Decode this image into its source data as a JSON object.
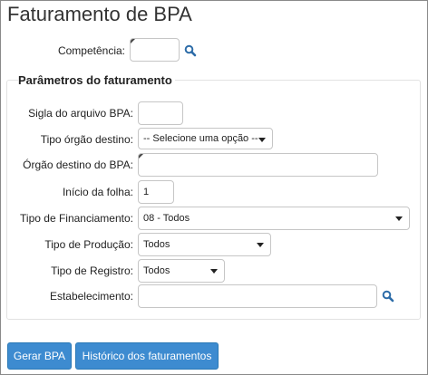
{
  "page": {
    "title": "Faturamento de BPA"
  },
  "competencia": {
    "label": "Competência:",
    "value": ""
  },
  "section": {
    "legend": "Parâmetros do faturamento"
  },
  "fields": {
    "sigla": {
      "label": "Sigla do arquivo BPA:",
      "value": ""
    },
    "tipo_orgao": {
      "label": "Tipo órgão destino:",
      "value": "-- Selecione uma opção --"
    },
    "orgao_destino": {
      "label": "Órgão destino do BPA:",
      "value": ""
    },
    "inicio_folha": {
      "label": "Início da folha:",
      "value": "1"
    },
    "tipo_financiamento": {
      "label": "Tipo de Financiamento:",
      "value": "08 - Todos"
    },
    "tipo_producao": {
      "label": "Tipo de Produção:",
      "value": "Todos"
    },
    "tipo_registro": {
      "label": "Tipo de Registro:",
      "value": "Todos"
    },
    "estabelecimento": {
      "label": "Estabelecimento:",
      "value": ""
    }
  },
  "buttons": {
    "gerar": "Gerar BPA",
    "historico": "Histórico dos faturamentos"
  },
  "icons": {
    "search": "search-icon"
  },
  "colors": {
    "primary_button": "#3d8bd0",
    "search_icon": "#2d6ca8"
  }
}
